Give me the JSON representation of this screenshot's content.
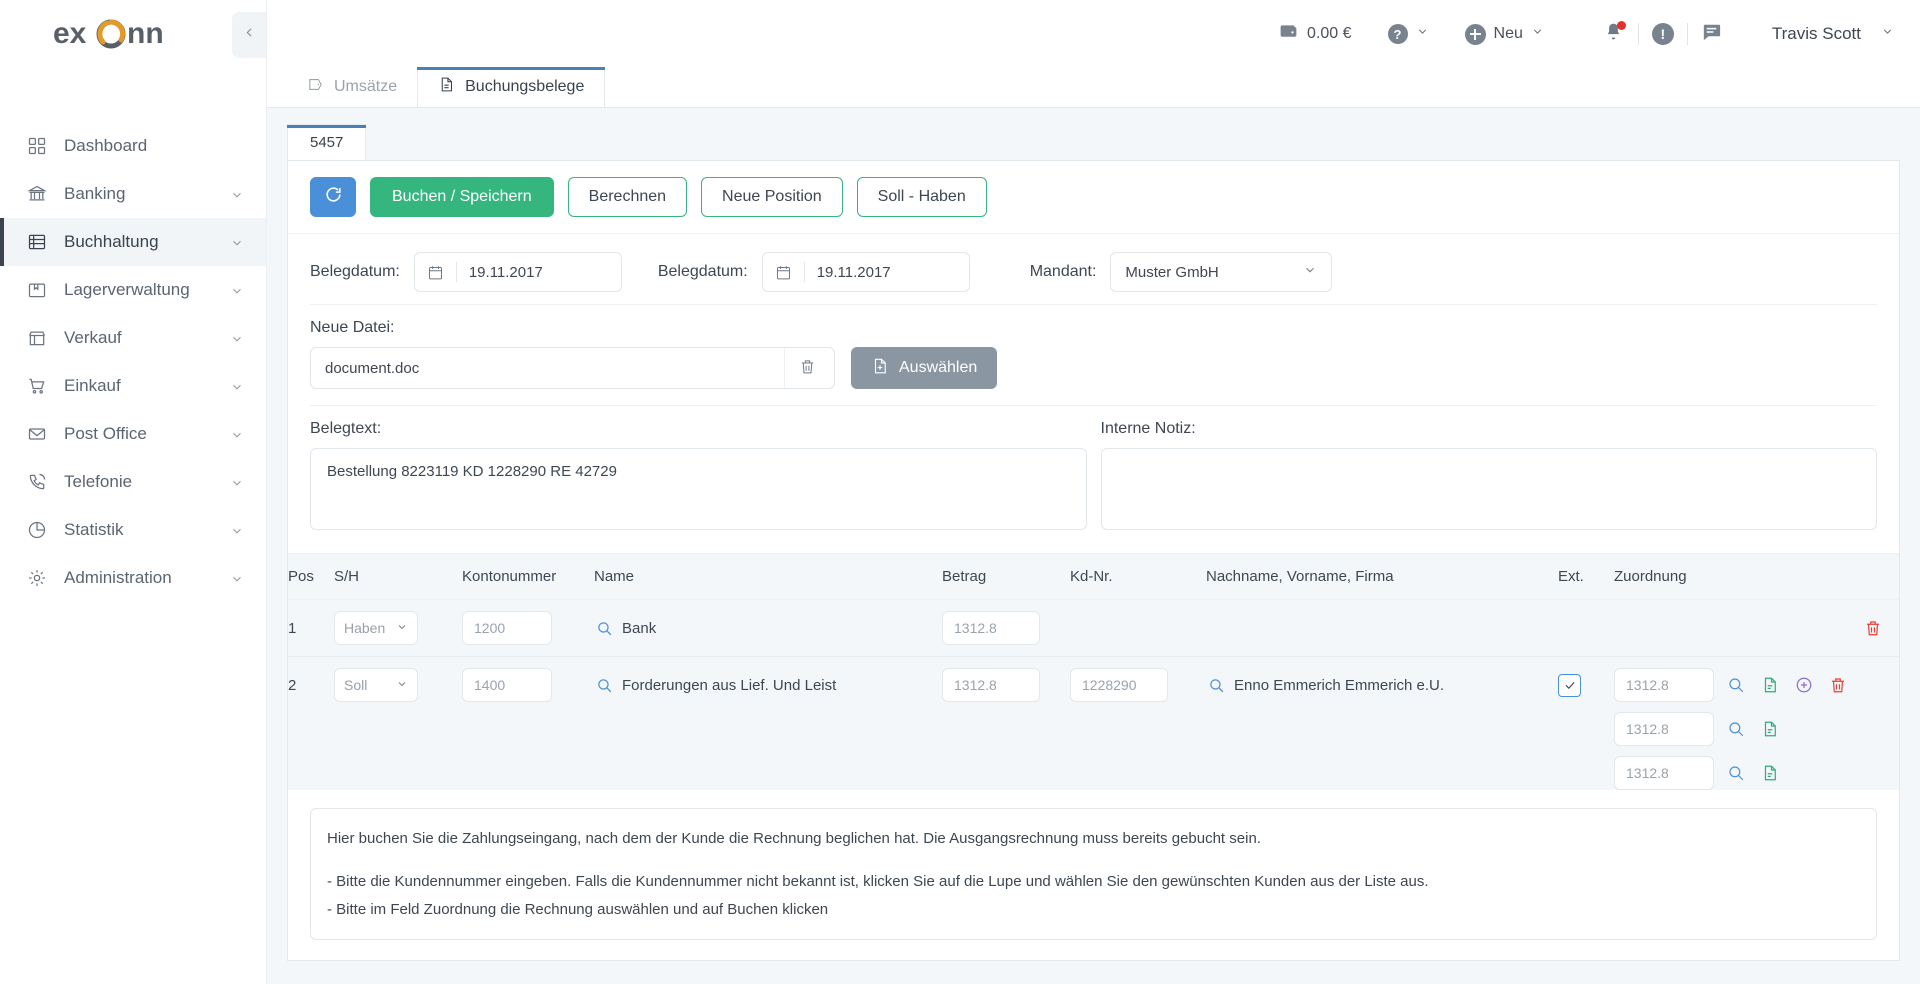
{
  "brand": {
    "name": "exonn",
    "accent": "#e39a26",
    "dark": "#595f66"
  },
  "colors": {
    "primary_green": "#35b67f",
    "refresh_blue": "#4a90d9",
    "tab_underline": "#4a80b5",
    "danger_red": "#ef3b34",
    "doc_green": "#2eaa74",
    "add_purple": "#8a6fd1",
    "page_bg": "#f4f7fa"
  },
  "sidebar": {
    "collapse_icon": "chevron-left-icon",
    "items": [
      {
        "label": "Dashboard",
        "icon": "grid-icon",
        "expandable": false,
        "active": false
      },
      {
        "label": "Banking",
        "icon": "bank-icon",
        "expandable": true,
        "active": false
      },
      {
        "label": "Buchhaltung",
        "icon": "ledger-icon",
        "expandable": true,
        "active": true
      },
      {
        "label": "Lagerverwaltung",
        "icon": "box-icon",
        "expandable": true,
        "active": false
      },
      {
        "label": "Verkauf",
        "icon": "store-icon",
        "expandable": true,
        "active": false
      },
      {
        "label": "Einkauf",
        "icon": "cart-icon",
        "expandable": true,
        "active": false
      },
      {
        "label": "Post Office",
        "icon": "envelope-icon",
        "expandable": true,
        "active": false
      },
      {
        "label": "Telefonie",
        "icon": "phone-icon",
        "expandable": true,
        "active": false
      },
      {
        "label": "Statistik",
        "icon": "pie-chart-icon",
        "expandable": true,
        "active": false
      },
      {
        "label": "Administration",
        "icon": "gear-icon",
        "expandable": true,
        "active": false
      }
    ]
  },
  "topbar": {
    "wallet_icon": "wallet-icon",
    "balance": "0.00 €",
    "help_icon": "question-circle-icon",
    "new_icon": "plus-circle-icon",
    "new_label": "Neu",
    "notifications_icon": "bell-icon",
    "notifications_badge": true,
    "alerts_icon": "exclamation-circle-icon",
    "messages_icon": "chat-icon",
    "user_name": "Travis Scott",
    "user_chevron": "chevron-down-icon"
  },
  "tabs": [
    {
      "label": "Umsätze",
      "icon": "tag-icon",
      "active": false
    },
    {
      "label": "Buchungsbelege",
      "icon": "document-icon",
      "active": true
    }
  ],
  "subtab": {
    "label": "5457"
  },
  "toolbar": {
    "refresh_icon": "refresh-icon",
    "buttons": [
      {
        "label": "Buchen / Speichern",
        "style": "primary"
      },
      {
        "label": "Berechnen",
        "style": "outline"
      },
      {
        "label": "Neue Position",
        "style": "outline"
      },
      {
        "label": "Soll - Haben",
        "style": "outline"
      }
    ]
  },
  "form": {
    "belegdatum_1": {
      "label": "Belegdatum:",
      "value": "19.11.2017",
      "icon": "calendar-icon"
    },
    "belegdatum_2": {
      "label": "Belegdatum:",
      "value": "19.11.2017",
      "icon": "calendar-icon"
    },
    "mandant": {
      "label": "Mandant:",
      "value": "Muster GmbH",
      "icon": "chevron-down-icon"
    },
    "neue_datei": {
      "label": "Neue Datei:",
      "file_name": "document.doc",
      "delete_icon": "trash-icon",
      "select_button": {
        "label": "Auswählen",
        "icon": "file-upload-icon"
      }
    },
    "belegtext": {
      "label": "Belegtext:",
      "value": "Bestellung 8223119 KD 1228290 RE 42729"
    },
    "interne_notiz": {
      "label": "Interne Notiz:",
      "value": ""
    }
  },
  "table": {
    "headers": [
      "Pos",
      "S/H",
      "Kontonummer",
      "Name",
      "Betrag",
      "Kd-Nr.",
      "Nachname, Vorname, Firma",
      "Ext.",
      "Zuordnung"
    ],
    "rows": [
      {
        "pos": "1",
        "sh": "Haben",
        "kontonummer": "1200",
        "name": "Bank",
        "name_search_icon": "search-icon",
        "betrag": "1312.8",
        "kd_nr": "",
        "nachname": "",
        "ext_checked": false,
        "zuordnung": [],
        "actions": [
          "trash-icon"
        ]
      },
      {
        "pos": "2",
        "sh": "Soll",
        "kontonummer": "1400",
        "name": "Forderungen aus Lief. Und Leist",
        "name_search_icon": "search-icon",
        "betrag": "1312.8",
        "kd_nr": "1228290",
        "nachname": "Enno Emmerich Emmerich e.U.",
        "nachname_search_icon": "search-icon",
        "ext_checked": true,
        "zuordnung": [
          {
            "value": "1312.8",
            "actions": [
              "search-icon",
              "document-icon",
              "plus-circle-icon",
              "trash-icon"
            ]
          },
          {
            "value": "1312.8",
            "actions": [
              "search-icon",
              "document-icon"
            ]
          },
          {
            "value": "1312.8",
            "actions": [
              "search-icon",
              "document-icon"
            ]
          }
        ],
        "actions": []
      }
    ]
  },
  "info": {
    "line1": "Hier buchen Sie die Zahlungseingang, nach dem der Kunde die Rechnung beglichen hat. Die Ausgangsrechnung muss bereits gebucht sein.",
    "line2": "- Bitte die Kundennummer eingeben. Falls die Kundennummer nicht bekannt ist, klicken Sie auf die Lupe und wählen Sie den gewünschten Kunden aus der Liste aus.",
    "line3": "- Bitte im Feld Zuordnung die Rechnung auswählen und auf Buchen klicken"
  }
}
